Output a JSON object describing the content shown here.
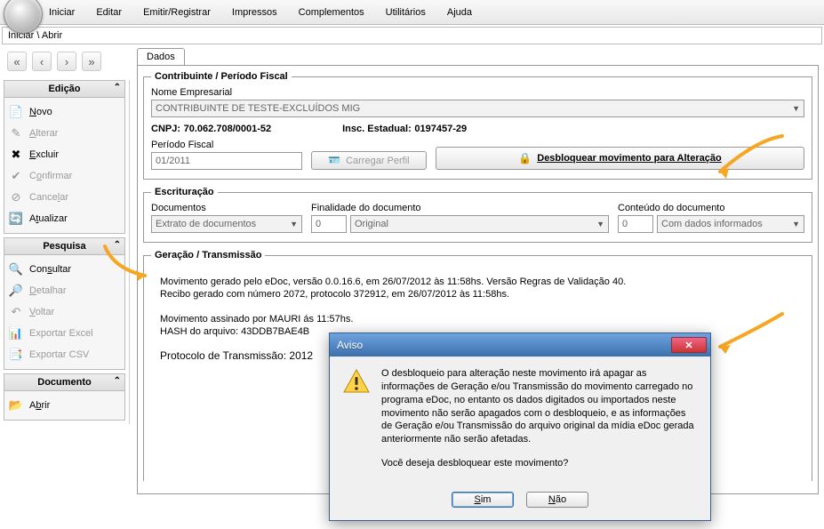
{
  "menu": {
    "iniciar": "Iniciar",
    "editar": "Editar",
    "emitir": "Emitir/Registrar",
    "impressos": "Impressos",
    "complementos": "Complementos",
    "utilitarios": "Utilitários",
    "ajuda": "Ajuda"
  },
  "breadcrumb": "Iniciar \\ Abrir",
  "sidebar": {
    "edicao": {
      "title": "Edição",
      "novo": "Novo",
      "alterar": "Alterar",
      "excluir": "Excluir",
      "confirmar": "Confirmar",
      "cancelar": "Cancelar",
      "atualizar": "Atualizar"
    },
    "pesquisa": {
      "title": "Pesquisa",
      "consultar": "Consultar",
      "detalhar": "Detalhar",
      "voltar": "Voltar",
      "exp_excel": "Exportar Excel",
      "exp_csv": "Exportar CSV"
    },
    "documento": {
      "title": "Documento",
      "abrir": "Abrir"
    }
  },
  "tab": {
    "dados": "Dados"
  },
  "contribuinte": {
    "legend": "Contribuinte / Período Fiscal",
    "nome_label": "Nome Empresarial",
    "nome_value": "CONTRIBUINTE DE TESTE-EXCLUÍDOS MIG",
    "cnpj_label": "CNPJ:",
    "cnpj_value": "70.062.708/0001-52",
    "insc_label": "Insc. Estadual:",
    "insc_value": "0197457-29",
    "periodo_label": "Período Fiscal",
    "periodo_value": "01/2011",
    "carregar_perfil": "Carregar Perfil",
    "desbloquear": "Desbloquear movimento para Alteração"
  },
  "escrituracao": {
    "legend": "Escrituração",
    "documentos_label": "Documentos",
    "documentos_value": "Extrato de documentos",
    "finalidade_label": "Finalidade do documento",
    "finalidade_code": "0",
    "finalidade_value": "Original",
    "conteudo_label": "Conteúdo do documento",
    "conteudo_code": "0",
    "conteudo_value": "Com dados informados"
  },
  "geracao": {
    "legend": "Geração / Transmissão",
    "line1": "Movimento gerado pelo eDoc, versão 0.0.16.6, em 26/07/2012 às 11:58hs. Versão Regras de Validação 40.",
    "line2": "Recibo gerado com número 2072, protocolo 372912, em 26/07/2012 às 11:58hs.",
    "line3": "Movimento assinado por MAURI                                                                                                                         ás 11:57hs.",
    "line4": "HASH do arquivo: 43DDB7BAE4B",
    "line5": "Protocolo de Transmissão: 2012"
  },
  "dialog": {
    "title": "Aviso",
    "message": "O desbloqueio para alteração neste movimento irá apagar as informações de Geração e/ou Transmissão do movimento carregado no programa eDoc, no entanto os dados digitados ou importados neste movimento não serão apagados com o desbloqueio, e as informações de Geração e/ou Transmissão do arquivo original da mídia eDoc gerada anteriormente não serão afetadas.",
    "question": "Você deseja desbloquear este movimento?",
    "sim": "Sim",
    "nao": "Não"
  }
}
